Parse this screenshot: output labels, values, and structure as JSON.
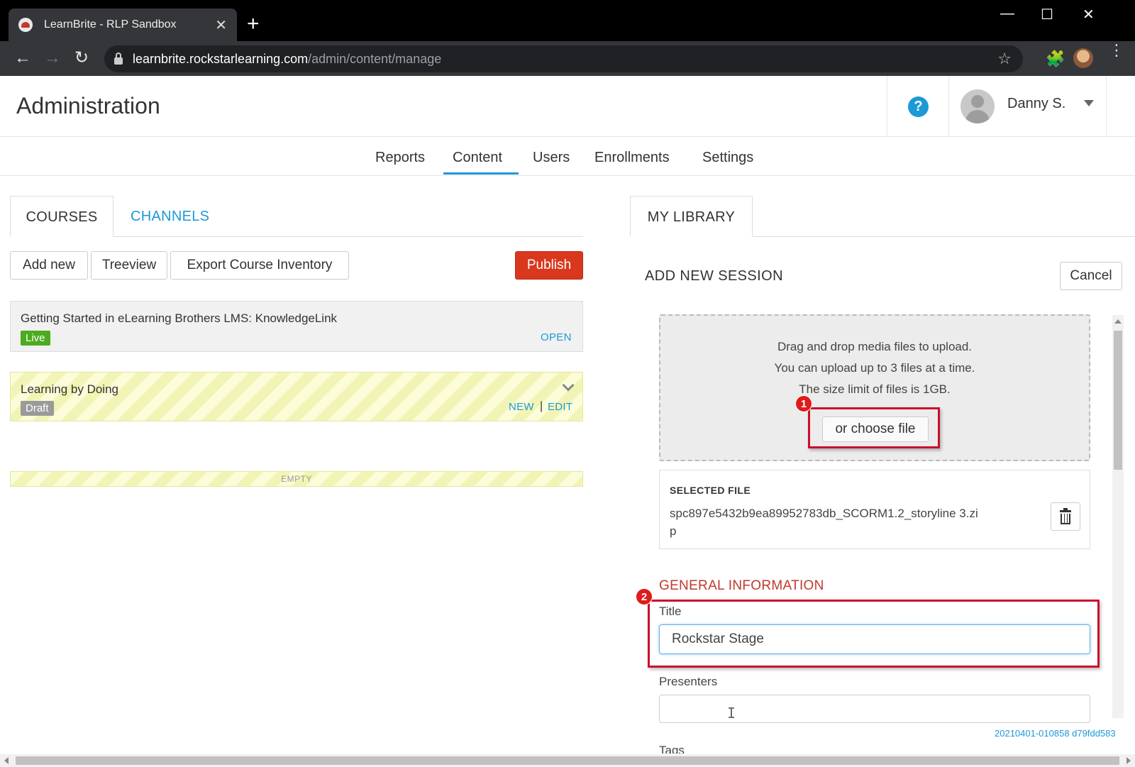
{
  "browser": {
    "tab_title": "LearnBrite - RLP Sandbox",
    "tab_close": "✕",
    "new_tab": "+",
    "url_host": "learnbrite.rockstarlearning.com",
    "url_path": "/admin/content/manage",
    "icons": {
      "back": "back-arrow-icon",
      "forward": "forward-arrow-icon",
      "reload": "reload-icon",
      "bookmark": "star-icon",
      "extensions": "puzzle-icon",
      "menu": "kebab-menu-icon"
    },
    "window_controls": {
      "minimize": "—",
      "maximize": "☐",
      "close": "✕"
    }
  },
  "header": {
    "title": "Administration",
    "help_glyph": "?",
    "user_name": "Danny S."
  },
  "nav": {
    "items": [
      {
        "label": "Reports"
      },
      {
        "label": "Content"
      },
      {
        "label": "Users"
      },
      {
        "label": "Enrollments"
      },
      {
        "label": "Settings"
      }
    ],
    "active": "Content"
  },
  "left": {
    "tabs": [
      {
        "label": "COURSES"
      },
      {
        "label": "CHANNELS"
      }
    ],
    "buttons": {
      "add_new": "Add new",
      "treeview": "Treeview",
      "export": "Export Course Inventory",
      "publish": "Publish"
    },
    "courses": [
      {
        "title": "Getting Started in eLearning Brothers LMS: KnowledgeLink",
        "status": "Live",
        "link": "OPEN"
      },
      {
        "title": "Learning by Doing",
        "status": "Draft",
        "link_new": "NEW",
        "separator": "|",
        "link_edit": "EDIT"
      }
    ],
    "empty_label": "EMPTY"
  },
  "right": {
    "tab": "MY LIBRARY",
    "session_title": "ADD NEW SESSION",
    "cancel": "Cancel",
    "dropzone": {
      "line1": "Drag and drop media files to upload.",
      "line2": "You can upload up to 3 files at a time.",
      "line3": "The size limit of files is 1GB.",
      "choose": "or choose file"
    },
    "selected": {
      "label": "SELECTED FILE",
      "filename": "spc897e5432b9ea89952783db_SCORM1.2_storyline 3.zip"
    },
    "general_info": "GENERAL INFORMATION",
    "fields": {
      "title_label": "Title",
      "title_value": "Rockstar Stage",
      "presenters_label": "Presenters",
      "presenters_value": "",
      "tags_label": "Tags"
    },
    "annotations": [
      "1",
      "2"
    ],
    "build": "20210401-010858 d79fdd583"
  },
  "colors": {
    "accent": "#1c9ad6",
    "publish": "#d9381e",
    "live": "#4cab1e",
    "draft": "#9a9a9a",
    "annotation": "#c8102e",
    "section_heading": "#c0392b"
  }
}
